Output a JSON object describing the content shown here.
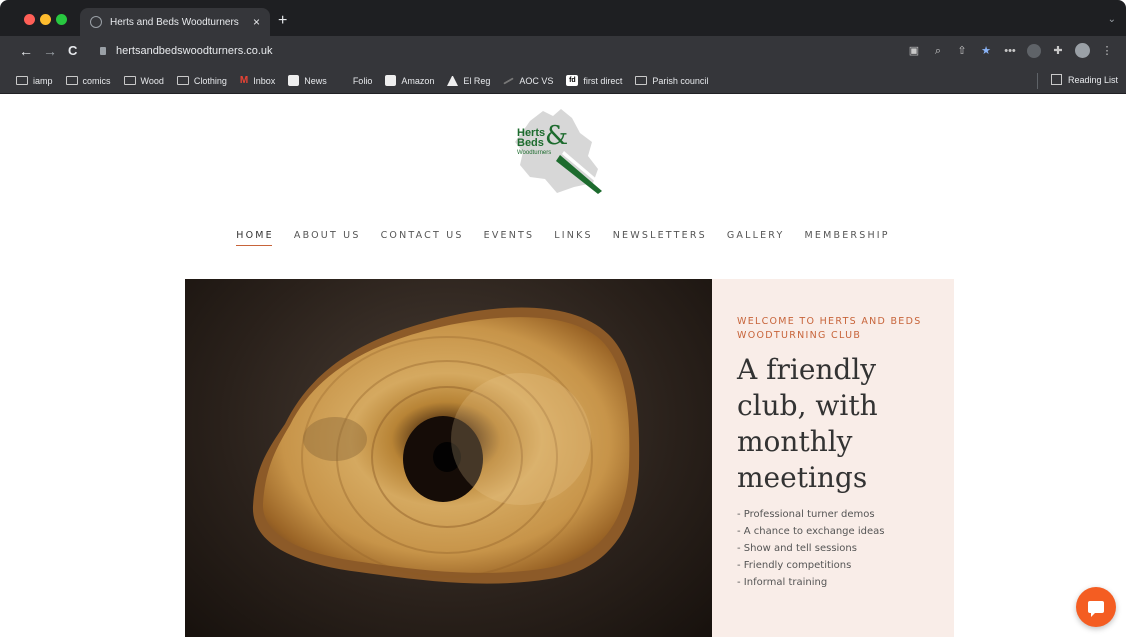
{
  "browser": {
    "tab_title": "Herts and Beds Woodturners",
    "url": "hertsandbedswoodturners.co.uk",
    "bookmarks": [
      {
        "label": "iamp",
        "icon": "folder-icon"
      },
      {
        "label": "comics",
        "icon": "folder-icon"
      },
      {
        "label": "Wood",
        "icon": "folder-icon"
      },
      {
        "label": "Clothing",
        "icon": "folder-icon"
      },
      {
        "label": "Inbox",
        "icon": "gmail-icon"
      },
      {
        "label": "News",
        "icon": "news-icon"
      },
      {
        "label": "Folio",
        "icon": "folio-icon"
      },
      {
        "label": "Amazon",
        "icon": "amazon-icon"
      },
      {
        "label": "El Reg",
        "icon": "elreg-icon"
      },
      {
        "label": "AOC VS",
        "icon": "aoc-icon"
      },
      {
        "label": "first direct",
        "icon": "first-direct-icon"
      },
      {
        "label": "Parish council",
        "icon": "folder-icon"
      }
    ],
    "reading_list": "Reading List"
  },
  "site": {
    "logo": {
      "line1": "Herts",
      "line2": "Beds",
      "amp": "&",
      "sub": "Woodturners"
    },
    "nav": [
      "HOME",
      "ABOUT US",
      "CONTACT US",
      "EVENTS",
      "LINKS",
      "NEWSLETTERS",
      "GALLERY",
      "MEMBERSHIP"
    ],
    "hero": {
      "kicker": "WELCOME TO HERTS AND BEDS WOODTURNING CLUB",
      "headline": "A friendly club, with monthly meetings",
      "features": [
        "- Professional turner demos",
        "- A chance to exchange ideas",
        "- Show and tell sessions",
        "- Friendly competitions",
        "- Informal training"
      ]
    }
  },
  "colors": {
    "accent": "#c7643a",
    "panel": "#f9ede8",
    "chat": "#f45d22",
    "logo_green": "#1d6b2e"
  }
}
